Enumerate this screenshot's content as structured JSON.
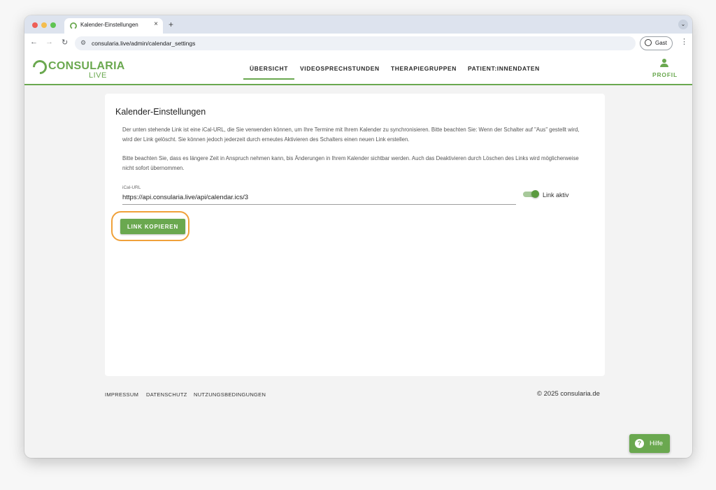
{
  "browser": {
    "tab_title": "Kalender-Einstellungen",
    "tab_close": "×",
    "new_tab": "+",
    "tab_menu": "⌄",
    "url": "consularia.live/admin/calendar_settings",
    "guest_label": "Gast",
    "back": "←",
    "forward": "→",
    "reload": "↻",
    "site_settings": "⚙",
    "menu": "⋮"
  },
  "app": {
    "logo_name": "CONSULARIA",
    "logo_sub": "LIVE",
    "nav": [
      {
        "label": "ÜBERSICHT",
        "active": true
      },
      {
        "label": "VIDEOSPRECHSTUNDEN",
        "active": false
      },
      {
        "label": "THERAPIEGRUPPEN",
        "active": false
      },
      {
        "label": "PATIENT:INNENDATEN",
        "active": false
      }
    ],
    "profile_label": "PROFIL",
    "accent_color": "#6aa84f"
  },
  "card": {
    "title": "Kalender-Einstellungen",
    "paragraph1": "Der unten stehende Link ist eine iCal-URL, die Sie verwenden können, um Ihre Termine mit Ihrem Kalender zu synchronisieren. Bitte beachten Sie: Wenn der Schalter auf \"Aus\" gestellt wird, wird der Link gelöscht. Sie können jedoch jederzeit durch erneutes Aktivieren des Schalters einen neuen Link erstellen.",
    "paragraph2": "Bitte beachten Sie, dass es längere Zeit in Anspruch nehmen kann, bis Änderungen in Ihrem Kalender sichtbar werden. Auch das Deaktivieren durch Löschen des Links wird möglicherweise nicht sofort übernommen.",
    "field_label": "iCal-URL",
    "field_value": "https://api.consularia.live/api/calendar.ics/3",
    "switch_label": "Link aktiv",
    "switch_on": true,
    "copy_button": "LINK KOPIEREN",
    "highlight_color": "#f0a13a"
  },
  "footer": {
    "links": [
      "IMPRESSUM",
      "DATENSCHUTZ",
      "NUTZUNGSBEDINGUNGEN"
    ],
    "copyright": "© 2025 consularia.de"
  },
  "help": {
    "icon": "?",
    "label": "Hilfe"
  }
}
